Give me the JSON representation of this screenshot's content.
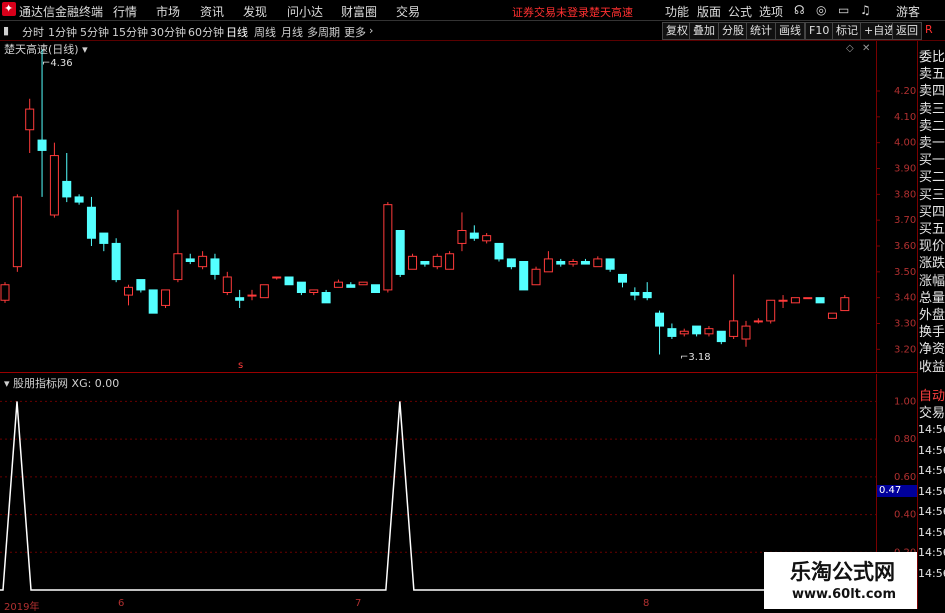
{
  "app": {
    "title": "通达信金融终端",
    "menu": [
      "行情",
      "市场",
      "资讯",
      "发现",
      "问小达",
      "财富圈",
      "交易"
    ],
    "status_red": "证券交易未登录",
    "stock_red": "楚天高速",
    "right_menu": [
      "功能",
      "版面",
      "公式",
      "选项"
    ],
    "guest": "游客",
    "right_badge": "R"
  },
  "toolbar": {
    "timeframes": [
      "分时",
      "1分钟",
      "5分钟",
      "15分钟",
      "30分钟",
      "60分钟",
      "日线",
      "周线",
      "月线",
      "多周期",
      "更多"
    ],
    "active": "日线",
    "buttons": [
      "复权",
      "叠加",
      "分股",
      "统计",
      "画线",
      "F10",
      "标记",
      "+自选",
      "返回"
    ]
  },
  "main_chart": {
    "title": "楚天高速(日线)",
    "high_label": "4.36",
    "low_label": "3.18",
    "marker": "s"
  },
  "indicator": {
    "title": "股朋指标网  XG: 0.00",
    "cursor_value": "0.47"
  },
  "side_panel": {
    "labels": [
      "委比",
      "卖五",
      "卖四",
      "卖三",
      "卖二",
      "卖一",
      "买一",
      "买二",
      "买三",
      "买四",
      "买五",
      "现价",
      "涨跌",
      "涨幅",
      "总量",
      "外盘",
      "换手",
      "净资",
      "收益"
    ],
    "labels2": [
      "自动",
      "交易"
    ],
    "times": [
      "14:56",
      "14:56",
      "14:56",
      "14:56",
      "14:56",
      "14:56",
      "14:56",
      "14:56"
    ]
  },
  "watermark": {
    "title": "乐淘公式网",
    "url": "www.60lt.com"
  },
  "colors": {
    "up": "#ff3b3b",
    "down": "#54ffff",
    "grid": "#7a0000",
    "axis_text": "#b03030"
  },
  "chart_data": [
    {
      "type": "candlestick",
      "title": "楚天高速(日线)",
      "ylim": [
        3.12,
        4.32
      ],
      "yticks": [
        3.2,
        3.3,
        3.4,
        3.5,
        3.6,
        3.7,
        3.8,
        3.9,
        4.0,
        4.1,
        4.2
      ],
      "x_labels": [
        "2019年",
        "6",
        "7",
        "8"
      ],
      "annotations": [
        {
          "text": "4.36"
        },
        {
          "text": "3.18"
        }
      ],
      "candles": [
        {
          "o": 3.39,
          "h": 3.46,
          "l": 3.38,
          "c": 3.45
        },
        {
          "o": 3.52,
          "h": 3.8,
          "l": 3.5,
          "c": 3.79
        },
        {
          "o": 4.05,
          "h": 4.17,
          "l": 3.96,
          "c": 4.13
        },
        {
          "o": 4.01,
          "h": 4.36,
          "l": 3.79,
          "c": 3.97
        },
        {
          "o": 3.72,
          "h": 4.0,
          "l": 3.71,
          "c": 3.95
        },
        {
          "o": 3.85,
          "h": 3.96,
          "l": 3.77,
          "c": 3.79
        },
        {
          "o": 3.79,
          "h": 3.8,
          "l": 3.76,
          "c": 3.77
        },
        {
          "o": 3.75,
          "h": 3.79,
          "l": 3.6,
          "c": 3.63
        },
        {
          "o": 3.65,
          "h": 3.65,
          "l": 3.58,
          "c": 3.61
        },
        {
          "o": 3.61,
          "h": 3.63,
          "l": 3.46,
          "c": 3.47
        },
        {
          "o": 3.41,
          "h": 3.45,
          "l": 3.37,
          "c": 3.44
        },
        {
          "o": 3.47,
          "h": 3.47,
          "l": 3.42,
          "c": 3.43
        },
        {
          "o": 3.43,
          "h": 3.43,
          "l": 3.34,
          "c": 3.34
        },
        {
          "o": 3.37,
          "h": 3.43,
          "l": 3.36,
          "c": 3.43
        },
        {
          "o": 3.47,
          "h": 3.74,
          "l": 3.46,
          "c": 3.57
        },
        {
          "o": 3.55,
          "h": 3.57,
          "l": 3.53,
          "c": 3.54
        },
        {
          "o": 3.52,
          "h": 3.58,
          "l": 3.51,
          "c": 3.56
        },
        {
          "o": 3.55,
          "h": 3.57,
          "l": 3.47,
          "c": 3.49
        },
        {
          "o": 3.42,
          "h": 3.5,
          "l": 3.41,
          "c": 3.48
        },
        {
          "o": 3.4,
          "h": 3.43,
          "l": 3.36,
          "c": 3.39
        },
        {
          "o": 3.41,
          "h": 3.43,
          "l": 3.39,
          "c": 3.41
        },
        {
          "o": 3.4,
          "h": 3.45,
          "l": 3.4,
          "c": 3.45
        },
        {
          "o": 3.48,
          "h": 3.48,
          "l": 3.47,
          "c": 3.48
        },
        {
          "o": 3.48,
          "h": 3.48,
          "l": 3.45,
          "c": 3.45
        },
        {
          "o": 3.46,
          "h": 3.46,
          "l": 3.41,
          "c": 3.42
        },
        {
          "o": 3.42,
          "h": 3.43,
          "l": 3.41,
          "c": 3.43
        },
        {
          "o": 3.42,
          "h": 3.43,
          "l": 3.38,
          "c": 3.38
        },
        {
          "o": 3.44,
          "h": 3.47,
          "l": 3.44,
          "c": 3.46
        },
        {
          "o": 3.45,
          "h": 3.46,
          "l": 3.44,
          "c": 3.44
        },
        {
          "o": 3.45,
          "h": 3.46,
          "l": 3.45,
          "c": 3.46
        },
        {
          "o": 3.45,
          "h": 3.45,
          "l": 3.42,
          "c": 3.42
        },
        {
          "o": 3.43,
          "h": 3.77,
          "l": 3.42,
          "c": 3.76
        },
        {
          "o": 3.66,
          "h": 3.66,
          "l": 3.48,
          "c": 3.49
        },
        {
          "o": 3.51,
          "h": 3.57,
          "l": 3.51,
          "c": 3.56
        },
        {
          "o": 3.54,
          "h": 3.54,
          "l": 3.52,
          "c": 3.53
        },
        {
          "o": 3.52,
          "h": 3.57,
          "l": 3.51,
          "c": 3.56
        },
        {
          "o": 3.51,
          "h": 3.58,
          "l": 3.51,
          "c": 3.57
        },
        {
          "o": 3.61,
          "h": 3.73,
          "l": 3.58,
          "c": 3.66
        },
        {
          "o": 3.65,
          "h": 3.68,
          "l": 3.62,
          "c": 3.63
        },
        {
          "o": 3.62,
          "h": 3.65,
          "l": 3.61,
          "c": 3.64
        },
        {
          "o": 3.61,
          "h": 3.61,
          "l": 3.54,
          "c": 3.55
        },
        {
          "o": 3.55,
          "h": 3.55,
          "l": 3.51,
          "c": 3.52
        },
        {
          "o": 3.54,
          "h": 3.54,
          "l": 3.43,
          "c": 3.43
        },
        {
          "o": 3.45,
          "h": 3.52,
          "l": 3.45,
          "c": 3.51
        },
        {
          "o": 3.5,
          "h": 3.58,
          "l": 3.5,
          "c": 3.55
        },
        {
          "o": 3.54,
          "h": 3.55,
          "l": 3.52,
          "c": 3.53
        },
        {
          "o": 3.53,
          "h": 3.55,
          "l": 3.52,
          "c": 3.54
        },
        {
          "o": 3.54,
          "h": 3.55,
          "l": 3.53,
          "c": 3.53
        },
        {
          "o": 3.52,
          "h": 3.56,
          "l": 3.52,
          "c": 3.55
        },
        {
          "o": 3.55,
          "h": 3.55,
          "l": 3.5,
          "c": 3.51
        },
        {
          "o": 3.49,
          "h": 3.49,
          "l": 3.44,
          "c": 3.46
        },
        {
          "o": 3.42,
          "h": 3.44,
          "l": 3.39,
          "c": 3.41
        },
        {
          "o": 3.42,
          "h": 3.46,
          "l": 3.39,
          "c": 3.4
        },
        {
          "o": 3.34,
          "h": 3.35,
          "l": 3.18,
          "c": 3.29
        },
        {
          "o": 3.28,
          "h": 3.3,
          "l": 3.24,
          "c": 3.25
        },
        {
          "o": 3.26,
          "h": 3.28,
          "l": 3.25,
          "c": 3.27
        },
        {
          "o": 3.29,
          "h": 3.29,
          "l": 3.25,
          "c": 3.26
        },
        {
          "o": 3.26,
          "h": 3.29,
          "l": 3.25,
          "c": 3.28
        },
        {
          "o": 3.27,
          "h": 3.27,
          "l": 3.22,
          "c": 3.23
        },
        {
          "o": 3.25,
          "h": 3.49,
          "l": 3.24,
          "c": 3.31
        },
        {
          "o": 3.24,
          "h": 3.31,
          "l": 3.21,
          "c": 3.29
        },
        {
          "o": 3.31,
          "h": 3.32,
          "l": 3.3,
          "c": 3.31
        },
        {
          "o": 3.31,
          "h": 3.39,
          "l": 3.3,
          "c": 3.39
        },
        {
          "o": 3.39,
          "h": 3.41,
          "l": 3.36,
          "c": 3.39
        },
        {
          "o": 3.38,
          "h": 3.4,
          "l": 3.38,
          "c": 3.4
        },
        {
          "o": 3.4,
          "h": 3.4,
          "l": 3.4,
          "c": 3.4
        },
        {
          "o": 3.4,
          "h": 3.4,
          "l": 3.38,
          "c": 3.38
        },
        {
          "o": 3.32,
          "h": 3.34,
          "l": 3.32,
          "c": 3.34
        },
        {
          "o": 3.35,
          "h": 3.41,
          "l": 3.35,
          "c": 3.4
        }
      ]
    },
    {
      "type": "line",
      "title": "股朋指标网  XG: 0.00",
      "ylim": [
        0,
        1.05
      ],
      "yticks": [
        0.2,
        0.4,
        0.6,
        0.8,
        1.0
      ],
      "series": [
        {
          "name": "XG",
          "peaks_at_index": [
            0,
            31
          ],
          "values_note": "impulse"
        }
      ]
    }
  ]
}
